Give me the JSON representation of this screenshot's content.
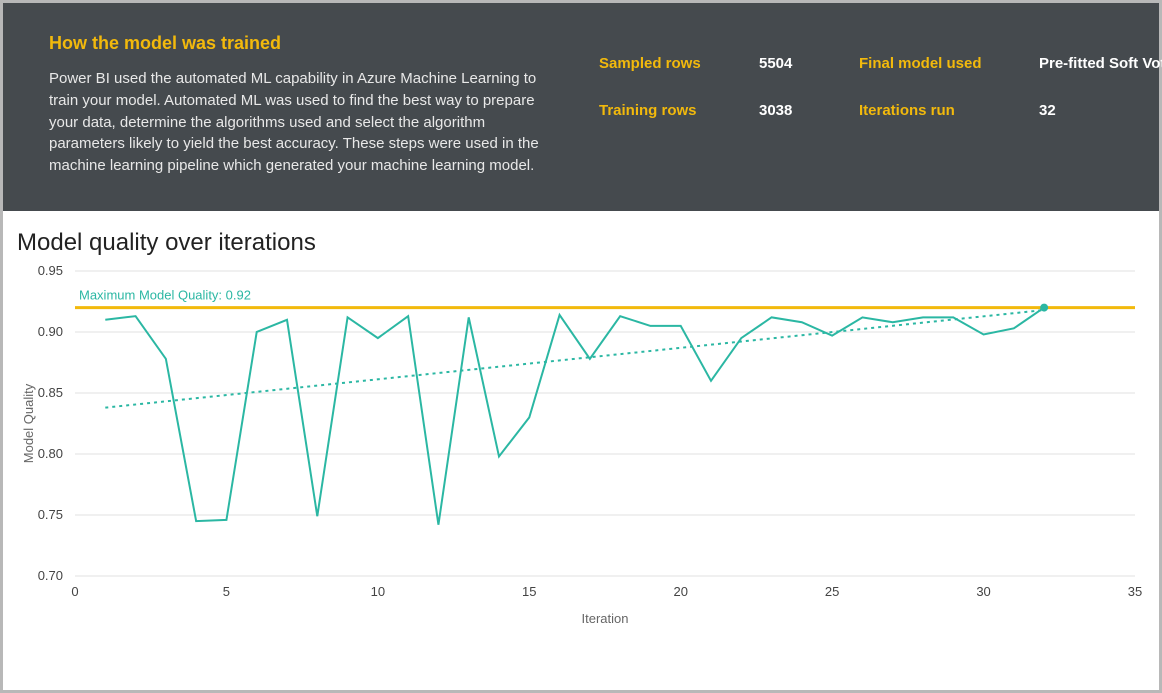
{
  "header": {
    "title": "How the model was trained",
    "body": "Power BI used the automated ML capability in Azure Machine Learning to train your model. Automated ML was used to find the best way to prepare your data, determine the algorithms used and select the algorithm parameters likely to yield the best accuracy. These steps were used in the machine learning pipeline which generated your machine learning model.",
    "stats": {
      "sampled_rows": {
        "label": "Sampled rows",
        "value": "5504"
      },
      "training_rows": {
        "label": "Training rows",
        "value": "3038"
      },
      "final_model": {
        "label": "Final model used",
        "value": "Pre-fitted Soft Voting Classifier"
      },
      "iterations_run": {
        "label": "Iterations run",
        "value": "32"
      }
    }
  },
  "chart_data": {
    "type": "line",
    "title": "Model quality over iterations",
    "xlabel": "Iteration",
    "ylabel": "Model Quality",
    "xlim": [
      0,
      35
    ],
    "ylim": [
      0.7,
      0.95
    ],
    "x_ticks": [
      0,
      5,
      10,
      15,
      20,
      25,
      30,
      35
    ],
    "y_ticks": [
      0.7,
      0.75,
      0.8,
      0.85,
      0.9,
      0.95
    ],
    "annotation": "Maximum Model Quality: 0.92",
    "max_line_value": 0.92,
    "trend": {
      "start": [
        1,
        0.838
      ],
      "end": [
        32,
        0.918
      ]
    },
    "series": [
      {
        "name": "Model Quality",
        "x": [
          1,
          2,
          3,
          4,
          5,
          6,
          7,
          8,
          9,
          10,
          11,
          12,
          13,
          14,
          15,
          16,
          17,
          18,
          19,
          20,
          21,
          22,
          23,
          24,
          25,
          26,
          27,
          28,
          29,
          30,
          31,
          32
        ],
        "y": [
          0.91,
          0.913,
          0.878,
          0.745,
          0.746,
          0.9,
          0.91,
          0.749,
          0.912,
          0.895,
          0.913,
          0.742,
          0.912,
          0.798,
          0.83,
          0.914,
          0.878,
          0.913,
          0.905,
          0.905,
          0.86,
          0.895,
          0.912,
          0.908,
          0.897,
          0.912,
          0.908,
          0.912,
          0.912,
          0.898,
          0.903,
          0.92
        ]
      }
    ]
  }
}
